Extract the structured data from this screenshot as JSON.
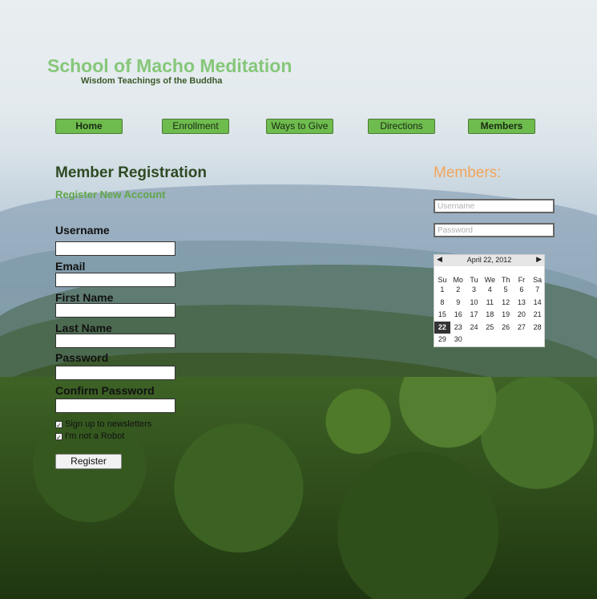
{
  "site": {
    "title": "School of Macho Meditation",
    "tagline": "Wisdom Teachings of the Buddha"
  },
  "nav": {
    "home": "Home",
    "enrollment": "Enrollment",
    "ways_to_give": "Ways to Give",
    "directions": "Directions",
    "members": "Members"
  },
  "registration": {
    "title": "Member Registration",
    "subtitle": "Register New Account",
    "fields": {
      "username": "Username",
      "email": "Email",
      "first_name": "First Name",
      "last_name": "Last Name",
      "password": "Password",
      "confirm_password": "Confirm Password"
    },
    "checkboxes": {
      "newsletter": "Sign up to newsletters",
      "robot": "I'm not a Robot"
    },
    "submit_label": "Register"
  },
  "members": {
    "title": "Members:",
    "username_placeholder": "Username",
    "password_placeholder": "Password"
  },
  "calendar": {
    "month_label": "April 22, 2012",
    "prev": "◀",
    "next": "▶",
    "dow": [
      "Su",
      "Mo",
      "Tu",
      "We",
      "Th",
      "Fr",
      "Sa"
    ],
    "weeks": [
      [
        "1",
        "2",
        "3",
        "4",
        "5",
        "6",
        "7"
      ],
      [
        "8",
        "9",
        "10",
        "11",
        "12",
        "13",
        "14"
      ],
      [
        "15",
        "16",
        "17",
        "18",
        "19",
        "20",
        "21"
      ],
      [
        "22",
        "23",
        "24",
        "25",
        "26",
        "27",
        "28"
      ],
      [
        "29",
        "30",
        "",
        "",
        "",
        "",
        ""
      ]
    ],
    "selected": "22"
  }
}
